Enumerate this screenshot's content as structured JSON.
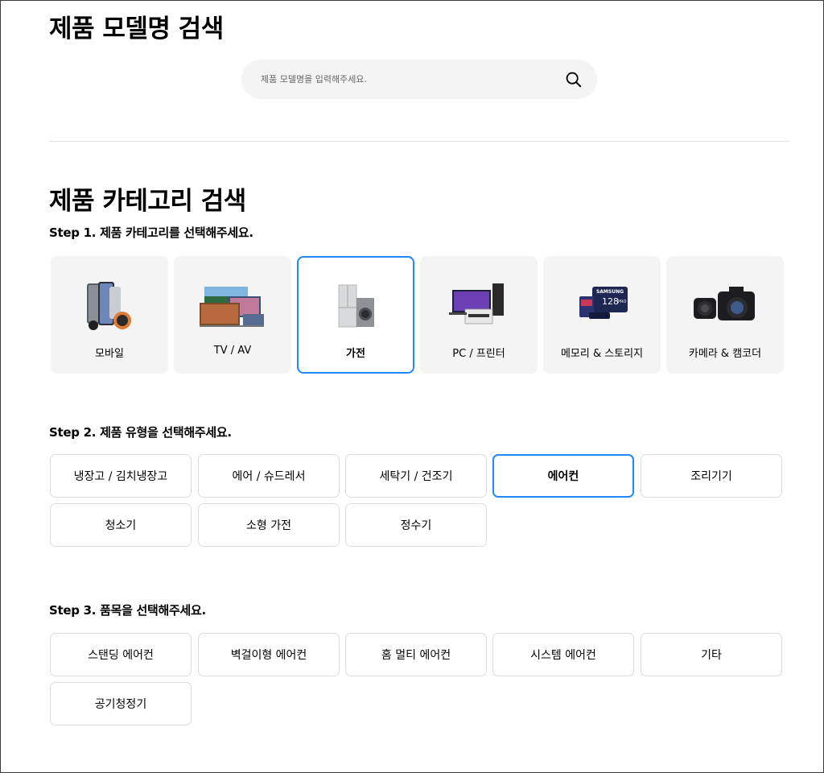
{
  "model_search": {
    "title": "제품 모델명 검색",
    "placeholder": "제품 모델명을 입력해주세요."
  },
  "category_search": {
    "title": "제품 카테고리 검색",
    "step1": {
      "title": "Step 1. 제품 카테고리를 선택해주세요.",
      "selected": "가전",
      "categories": [
        {
          "label": "모바일",
          "icon": "mobile-product-icon"
        },
        {
          "label": "TV / AV",
          "icon": "tv-product-icon"
        },
        {
          "label": "가전",
          "icon": "appliance-product-icon"
        },
        {
          "label": "PC / 프린터",
          "icon": "pc-printer-product-icon"
        },
        {
          "label": "메모리 & 스토리지",
          "icon": "memory-card-product-icon"
        },
        {
          "label": "카메라 & 캠코더",
          "icon": "camera-product-icon"
        }
      ],
      "memory_card_print": {
        "brand": "SAMSUNG",
        "capacity": "128",
        "tier": "PRO"
      }
    },
    "step2": {
      "title": "Step 2. 제품 유형을 선택해주세요.",
      "selected": "에어컨",
      "types": [
        "냉장고 / 김치냉장고",
        "에어 / 슈드레서",
        "세탁기 / 건조기",
        "에어컨",
        "조리기기",
        "청소기",
        "소형 가전",
        "정수기"
      ]
    },
    "step3": {
      "title": "Step 3. 품목을 선택해주세요.",
      "items": [
        "스탠딩 에어컨",
        "벽걸이형 에어컨",
        "홈 멀티 에어컨",
        "시스템 에어컨",
        "기타",
        "공기청정기"
      ]
    }
  },
  "colors": {
    "accent": "#2189ff",
    "tile_bg": "#f4f4f4",
    "border": "#dcdcdc"
  }
}
